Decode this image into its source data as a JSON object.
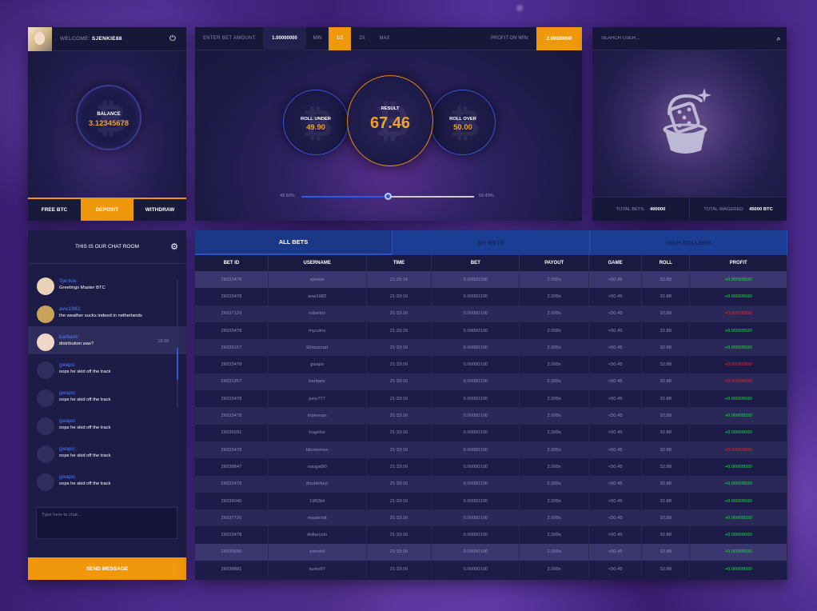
{
  "user": {
    "welcome_label": "WELCOME:",
    "username": "SJENKIE88",
    "balance_label": "BALANCE",
    "balance_value": "3.12345678",
    "tabs": [
      "FREE BTC",
      "DEPOSIT",
      "WITHDRAW"
    ],
    "active_tab": "DEPOSIT"
  },
  "bet": {
    "enter_label": "ENTER BET AMOUNT:",
    "amount": "1.00000000",
    "buttons": [
      "MIN",
      "1/2",
      "2X",
      "MAX"
    ],
    "active_button": "1/2",
    "profit_label": "PROFIT ON WIN:",
    "profit_value": "2.00000000",
    "roll_under_label": "ROLL UNDER",
    "roll_under_value": "49.90",
    "result_label": "RESULT",
    "result_value": "67.46",
    "roll_over_label": "ROLL OVER",
    "roll_over_value": "50.00",
    "slider_left": "49.50%",
    "slider_right": "50.49%",
    "slider_position": 0.5
  },
  "stats": {
    "search_placeholder": "SEARCH USER...",
    "total_bets_label": "TOTAL BETS:",
    "total_bets_value": "400000",
    "total_wagered_label": "TOTAL WAGERED:",
    "total_wagered_value": "45000 BTC"
  },
  "chat": {
    "title": "THIS IS OUR CHAT ROOM",
    "messages": [
      {
        "name": "Sjenkie:",
        "text": "Greetings Master BTC",
        "time": ""
      },
      {
        "name": "avw1982:",
        "text": "the weather sucks indeed in netherlands",
        "time": ""
      },
      {
        "name": "barbarik:",
        "text": "distribution was?",
        "time": "19:30"
      },
      {
        "name": "gwapo:",
        "text": "oops he skid off the track",
        "time": ""
      },
      {
        "name": "gwapo:",
        "text": "oops he skid off the track",
        "time": ""
      },
      {
        "name": "gwapo:",
        "text": "oops he skid off the track",
        "time": ""
      },
      {
        "name": "gwapo:",
        "text": "oops he skid off the track",
        "time": ""
      },
      {
        "name": "gwapo:",
        "text": "oops he skid off the track",
        "time": ""
      }
    ],
    "input_placeholder": "Type here to chat...",
    "send_label": "SEND MESSAGE"
  },
  "bets_table": {
    "tabs": [
      "ALL BETS",
      "MY BETS",
      "HIGH ROLLERS"
    ],
    "columns": [
      "BET ID",
      "USERNAME",
      "TIME",
      "BET",
      "PAYOUT",
      "GAME",
      "ROLL",
      "PROFIT"
    ],
    "rows": [
      [
        "26033478",
        "sjenkie",
        "21:33:16",
        "0.00000100",
        "2.000x",
        "<50.45",
        "32.88",
        "+0.00000500"
      ],
      [
        "26033478",
        "avw1982",
        "21:33:16",
        "0.00000100",
        "2.000x",
        "<50.45",
        "32.88",
        "+0.00000500"
      ],
      [
        "26037129",
        "robertxx",
        "21:33:16",
        "0.00000100",
        "2.000x",
        "<50.45",
        "32.88",
        "+0.00000500"
      ],
      [
        "26033478",
        "mycoins",
        "21:33:16",
        "0.00000100",
        "2.000x",
        "<50.45",
        "32.88",
        "+0.00000500"
      ],
      [
        "26039157",
        "90mozzart",
        "21:33:16",
        "0.00000100",
        "2.000x",
        "<50.45",
        "32.88",
        "+0.00000500"
      ],
      [
        "26033478",
        "gwapo",
        "21:33:16",
        "0.00000100",
        "2.000x",
        "<50.45",
        "32.88",
        "+0.00000500"
      ],
      [
        "26031257",
        "barbaric",
        "21:33:16",
        "0.00000100",
        "2.000x",
        "<50.45",
        "32.88",
        "+0.00000500"
      ],
      [
        "26033478",
        "juno777",
        "21:33:16",
        "0.00000100",
        "2.000x",
        "<50.45",
        "32.88",
        "+0.00000500"
      ],
      [
        "26033478",
        "tripleman",
        "21:33:16",
        "0.00000100",
        "2.000x",
        "<50.45",
        "32.88",
        "+0.00000500"
      ],
      [
        "26035591",
        "hugefox",
        "21:33:16",
        "0.00000100",
        "2.000x",
        "<50.45",
        "32.88",
        "+0.00000500"
      ],
      [
        "26033478",
        "bitcoinman",
        "21:33:16",
        "0.00000100",
        "2.000x",
        "<50.45",
        "32.88",
        "+0.00000500"
      ],
      [
        "26038847",
        "nougat90",
        "21:33:16",
        "0.00000100",
        "2.000x",
        "<50.45",
        "32.88",
        "+0.00000500"
      ],
      [
        "26033478",
        "doublefour",
        "21:33:16",
        "0.00000100",
        "2.000x",
        "<50.45",
        "32.88",
        "+0.00000500"
      ],
      [
        "26039045",
        "1982bit",
        "21:33:16",
        "0.00000100",
        "2.000x",
        "<50.45",
        "32.88",
        "+0.00000500"
      ],
      [
        "26037720",
        "masterbit",
        "21:33:16",
        "0.00000100",
        "2.000x",
        "<50.45",
        "32.88",
        "+0.00000500"
      ],
      [
        "26033478",
        "dollarcoin",
        "21:33:16",
        "0.00000100",
        "2.000x",
        "<50.45",
        "32.88",
        "+0.00000500"
      ],
      [
        "26035690",
        "extrebit",
        "21:33:16",
        "0.00000100",
        "2.000x",
        "<50.45",
        "32.88",
        "+0.00000500"
      ],
      [
        "26038881",
        "sumo87",
        "21:33:16",
        "0.00000100",
        "2.000x",
        "<50.45",
        "32.88",
        "+0.00000500"
      ]
    ],
    "profit_colors": [
      "green",
      "green",
      "red",
      "green",
      "green",
      "red",
      "red",
      "green",
      "green",
      "green",
      "red",
      "green",
      "green",
      "green",
      "green",
      "green",
      "green",
      "green"
    ],
    "highlight_rows": [
      0,
      16
    ]
  },
  "colors": {
    "accent_orange": "#f0980c",
    "accent_blue": "#2e5ae0",
    "profit_green": "#23d94a",
    "profit_red": "#e62828"
  },
  "icons": [
    "power-icon",
    "bitcoin-icon",
    "search-icon",
    "dice-logo-icon",
    "gear-icon"
  ]
}
